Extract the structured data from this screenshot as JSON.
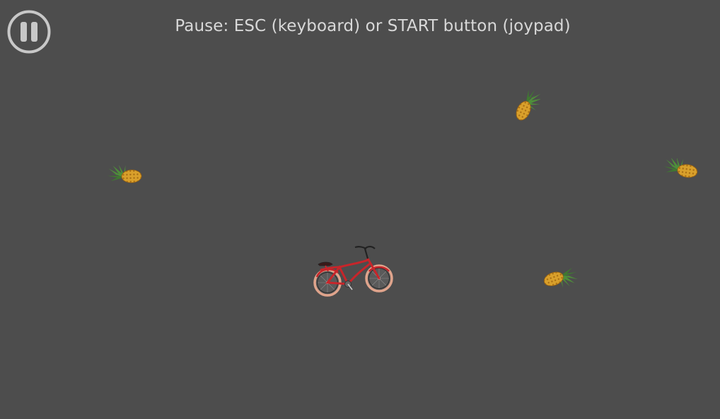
{
  "hud": {
    "pause_hint": "Pause: ESC (keyboard) or START button (joypad)",
    "pause_button_icon": "pause-icon"
  },
  "colors": {
    "background": "#4d4d4d",
    "hud_text": "#d8d8d8",
    "pause_button": "#c8c8c8",
    "bicycle_frame": "#c8252a",
    "bicycle_tire": "#e0a48c",
    "pineapple_body": "#d9a02b",
    "pineapple_leaves": "#4e8f3a"
  },
  "entities": {
    "player": "bicycle",
    "pickups": [
      "pineapple",
      "pineapple",
      "pineapple",
      "pineapple"
    ]
  }
}
